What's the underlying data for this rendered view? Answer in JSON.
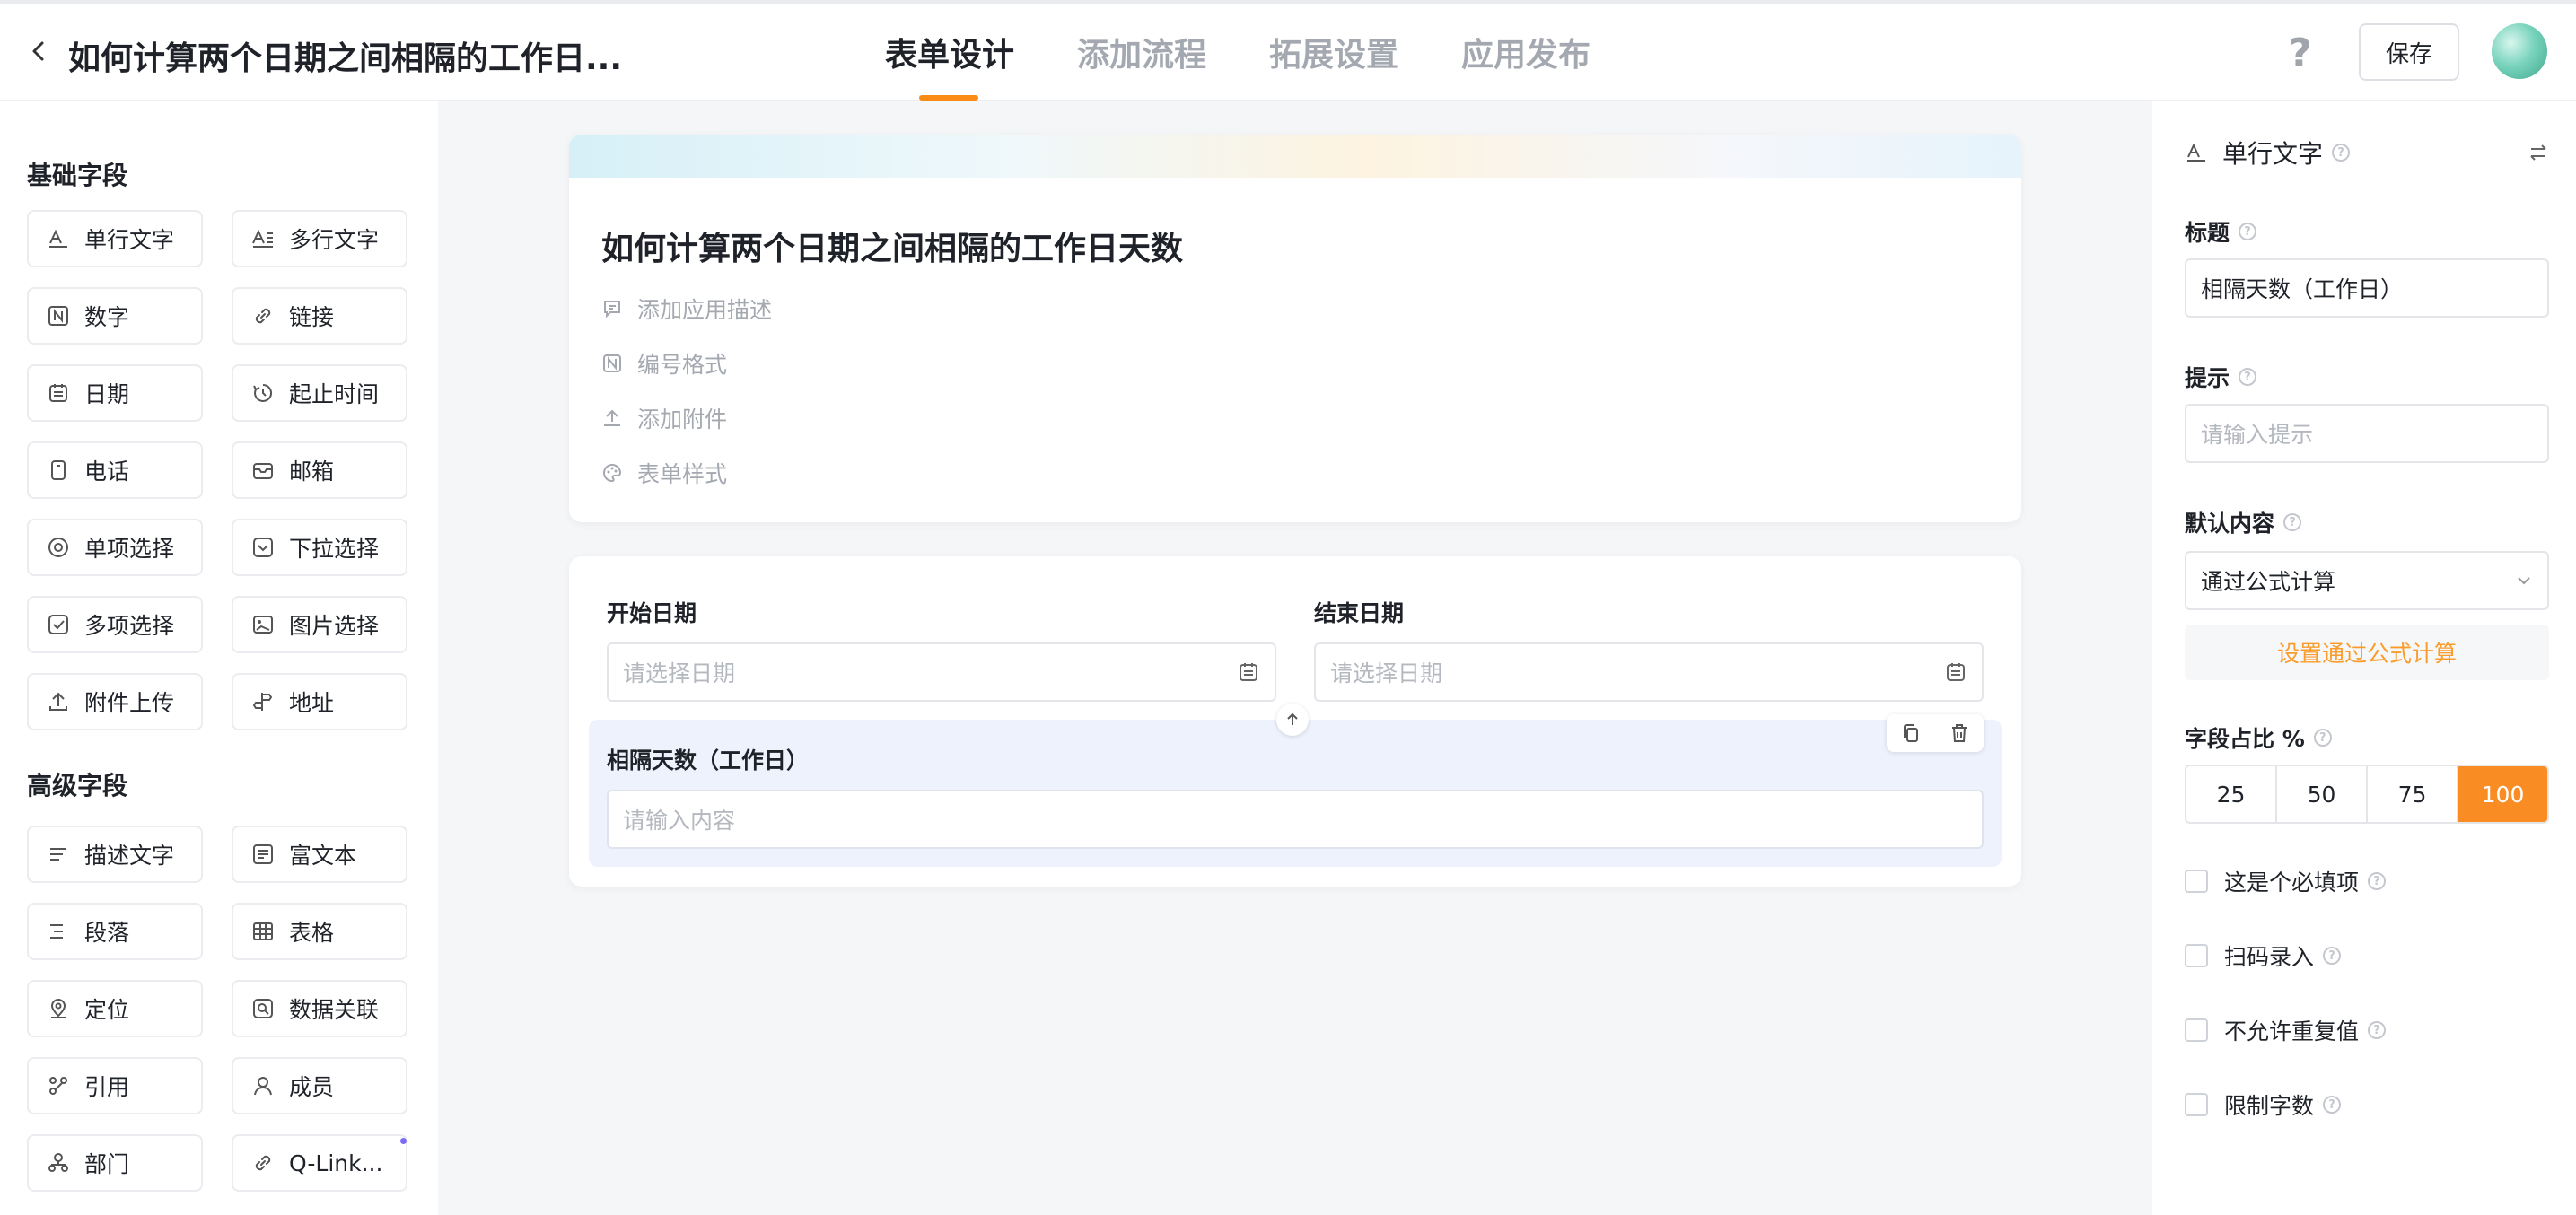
{
  "header": {
    "title": "如何计算两个日期之间相隔的工作日...",
    "tabs": [
      "表单设计",
      "添加流程",
      "拓展设置",
      "应用发布"
    ],
    "active_tab": "表单设计",
    "help": "?",
    "save_label": "保存"
  },
  "left": {
    "basic_title": "基础字段",
    "basic": [
      {
        "label": "单行文字",
        "icon": "single-line-text-icon"
      },
      {
        "label": "多行文字",
        "icon": "multi-line-text-icon"
      },
      {
        "label": "数字",
        "icon": "number-icon"
      },
      {
        "label": "链接",
        "icon": "link-icon"
      },
      {
        "label": "日期",
        "icon": "calendar-icon"
      },
      {
        "label": "起止时间",
        "icon": "time-range-icon"
      },
      {
        "label": "电话",
        "icon": "phone-icon"
      },
      {
        "label": "邮箱",
        "icon": "mail-icon"
      },
      {
        "label": "单项选择",
        "icon": "radio-icon"
      },
      {
        "label": "下拉选择",
        "icon": "dropdown-icon"
      },
      {
        "label": "多项选择",
        "icon": "checkbox-icon"
      },
      {
        "label": "图片选择",
        "icon": "image-icon"
      },
      {
        "label": "附件上传",
        "icon": "upload-icon"
      },
      {
        "label": "地址",
        "icon": "address-icon"
      }
    ],
    "advanced_title": "高级字段",
    "advanced": [
      {
        "label": "描述文字",
        "icon": "description-icon"
      },
      {
        "label": "富文本",
        "icon": "rich-text-icon"
      },
      {
        "label": "段落",
        "icon": "paragraph-icon"
      },
      {
        "label": "表格",
        "icon": "table-icon"
      },
      {
        "label": "定位",
        "icon": "location-icon"
      },
      {
        "label": "数据关联",
        "icon": "data-link-icon"
      },
      {
        "label": "引用",
        "icon": "reference-icon"
      },
      {
        "label": "成员",
        "icon": "member-icon"
      },
      {
        "label": "部门",
        "icon": "department-icon"
      },
      {
        "label": "Q-Link...",
        "icon": "q-link-icon"
      }
    ]
  },
  "form": {
    "title": "如何计算两个日期之间相隔的工作日天数",
    "meta": [
      "添加应用描述",
      "编号格式",
      "添加附件",
      "表单样式"
    ],
    "start_label": "开始日期",
    "start_placeholder": "请选择日期",
    "end_label": "结束日期",
    "end_placeholder": "请选择日期",
    "days_label": "相隔天数（工作日）",
    "days_placeholder": "请输入内容"
  },
  "props": {
    "field_type": "单行文字",
    "title_label": "标题",
    "title_value": "相隔天数（工作日）",
    "hint_label": "提示",
    "hint_placeholder": "请输入提示",
    "default_label": "默认内容",
    "default_value": "通过公式计算",
    "formula_button": "设置通过公式计算",
    "ratio_label": "字段占比 %",
    "ratio_options": [
      "25",
      "50",
      "75",
      "100"
    ],
    "ratio_selected": "100",
    "checkboxes": [
      "这是个必填项",
      "扫码录入",
      "不允许重复值",
      "限制字数"
    ]
  },
  "colors": {
    "accent": "#fa8c16",
    "selected_block": "#eef2fc",
    "formula_text": "#fa9c2c"
  }
}
